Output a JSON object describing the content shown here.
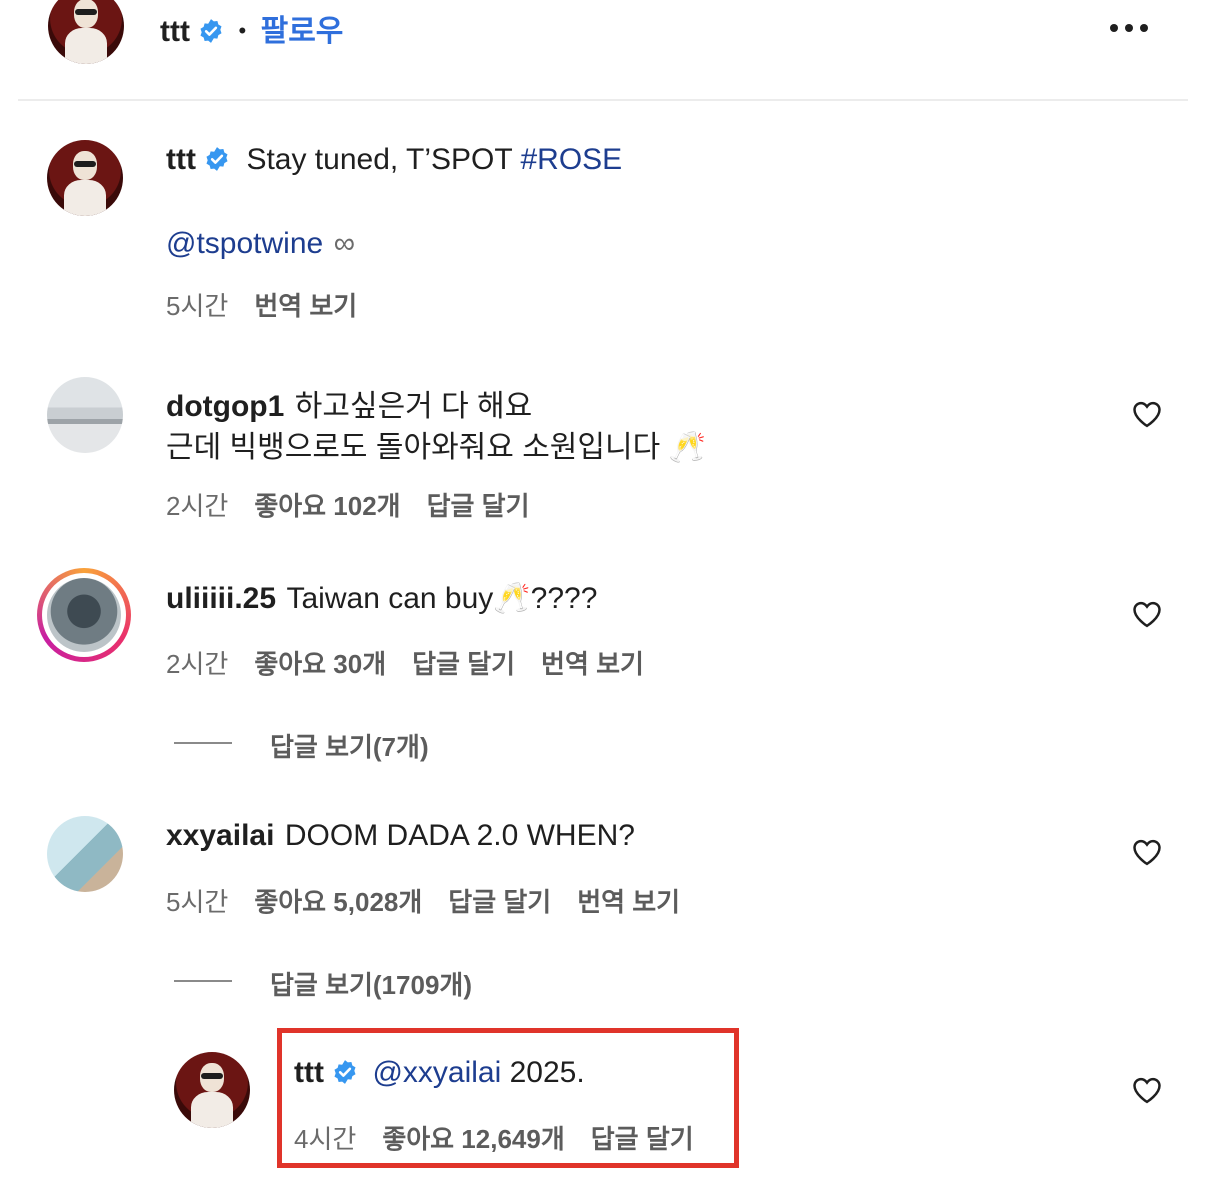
{
  "header": {
    "username": "ttt",
    "dot": "•",
    "follow": "팔로우",
    "more": "•••"
  },
  "caption": {
    "username": "ttt",
    "text_before": "Stay tuned, T’SPOT ",
    "hashtag": "#ROSE",
    "mention": "@tspotwine",
    "infinity": "∞",
    "time": "5시간",
    "translate": "번역 보기"
  },
  "comments": [
    {
      "username": "dotgop1",
      "line1": "하고싶은거 다 해요",
      "line2": "근데 빅뱅으로도 돌아와줘요 소원입니다 🥂",
      "time": "2시간",
      "likes": "좋아요 102개",
      "reply": "답글 달기"
    },
    {
      "username": "uliiiii.25",
      "text": "Taiwan can buy🥂????",
      "time": "2시간",
      "likes": "좋아요 30개",
      "reply": "답글 달기",
      "translate": "번역 보기",
      "view_replies": "답글 보기(7개)"
    },
    {
      "username": "xxyailai",
      "text": "DOOM DADA 2.0 WHEN?",
      "time": "5시간",
      "likes": "좋아요 5,028개",
      "reply": "답글 달기",
      "translate": "번역 보기",
      "view_replies": "답글 보기(1709개)"
    }
  ],
  "reply": {
    "username": "ttt",
    "mention": "@xxyailai",
    "text": " 2025.",
    "time": "4시간",
    "likes": "좋아요 12,649개",
    "reply": "답글 달기"
  },
  "colors": {
    "link": "#1d3d8f",
    "verified": "#3797f0",
    "highlight_box": "#e0342a",
    "follow": "#2f6fdc"
  }
}
